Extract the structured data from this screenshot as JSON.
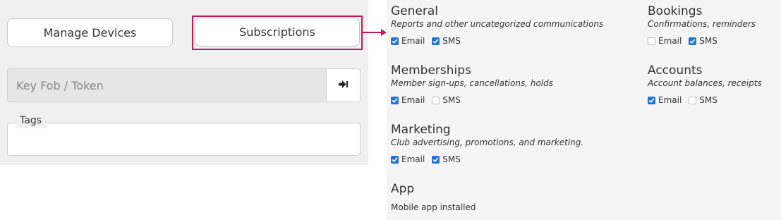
{
  "left": {
    "manage_devices_label": "Manage Devices",
    "subscriptions_label": "Subscriptions",
    "keyfob_placeholder": "Key Fob / Token",
    "tags_label": "Tags"
  },
  "categories": {
    "general": {
      "title": "General",
      "desc": "Reports and other uncategorized communications",
      "email_label": "Email",
      "email_checked": true,
      "sms_label": "SMS",
      "sms_checked": true
    },
    "bookings": {
      "title": "Bookings",
      "desc": "Confirmations, reminders",
      "email_label": "Email",
      "email_checked": false,
      "sms_label": "SMS",
      "sms_checked": true
    },
    "memberships": {
      "title": "Memberships",
      "desc": "Member sign-ups, cancellations, holds",
      "email_label": "Email",
      "email_checked": true,
      "sms_label": "SMS",
      "sms_checked": false
    },
    "accounts": {
      "title": "Accounts",
      "desc": "Account balances, receipts",
      "email_label": "Email",
      "email_checked": true,
      "sms_label": "SMS",
      "sms_checked": false
    },
    "marketing": {
      "title": "Marketing",
      "desc": "Club advertising, promotions, and marketing.",
      "email_label": "Email",
      "email_checked": true,
      "sms_label": "SMS",
      "sms_checked": true
    },
    "app": {
      "title": "App",
      "status": "Mobile app installed"
    }
  },
  "colors": {
    "highlight": "#c2185b",
    "checkbox_checked": "#1e73d6"
  }
}
